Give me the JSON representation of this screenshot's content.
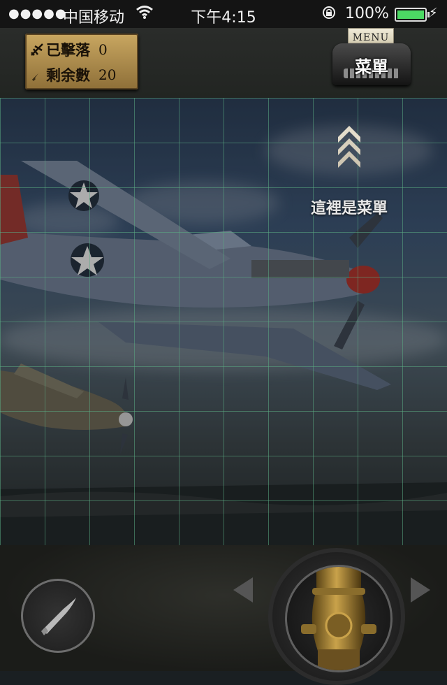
{
  "status_bar": {
    "signal": "●●●●●",
    "carrier": "中国移动",
    "time": "下午4:15",
    "battery_percent": "100%",
    "battery_level": 1.0,
    "icons": [
      "signal-dots-icon",
      "wifi-icon",
      "rotation-lock-icon",
      "battery-icon",
      "charging-bolt-icon"
    ]
  },
  "hud": {
    "shot_down_label": "已擊落",
    "shot_down_value": "0",
    "remaining_label": "剩余數",
    "remaining_value": "20",
    "menu_paper_text": "MENU",
    "menu_label": "菜單"
  },
  "battlefield": {
    "hint_text": "這裡是菜單",
    "grid_columns": 10,
    "grid_rows": 10
  },
  "colors": {
    "plate": "#c9a761",
    "grid_line": "#5aaa82",
    "battery_green": "#4cd964"
  }
}
